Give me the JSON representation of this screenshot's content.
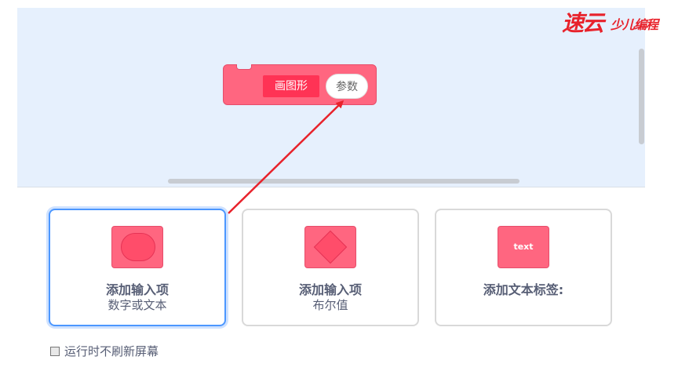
{
  "logo": {
    "main": "速云",
    "sub": "少儿编程"
  },
  "block": {
    "name": "画图形",
    "param": "参数"
  },
  "cards": [
    {
      "title": "添加输入项",
      "subtitle": "数字或文本",
      "icon": "oval-input-icon"
    },
    {
      "title": "添加输入项",
      "subtitle": "布尔值",
      "icon": "diamond-boolean-icon"
    },
    {
      "title": "添加文本标签:",
      "subtitle": "",
      "icon": "text-label-icon",
      "icon_text": "text"
    }
  ],
  "option": {
    "label": "运行时不刷新屏幕",
    "checked": false
  },
  "colors": {
    "block": "#ff6680",
    "accent": "#4c97ff",
    "arrow": "#e8222b"
  }
}
